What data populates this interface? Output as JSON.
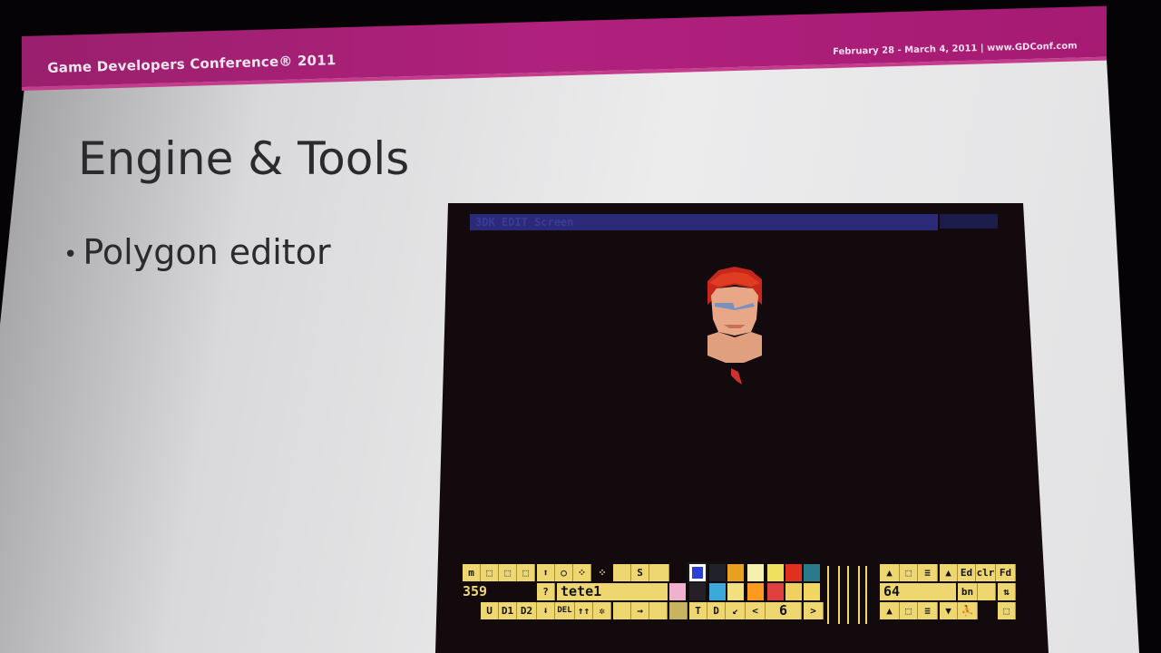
{
  "slide": {
    "conference": "Game Developers Conference® 2011",
    "dates_url": "February 28 - March 4, 2011 | www.GDConf.com",
    "title": "Engine & Tools",
    "bullets": [
      "Polygon editor"
    ]
  },
  "editor": {
    "titlebar": "3DK  EDIT  Screen",
    "titlebar_right": "",
    "toolbar": {
      "row1_left": [
        "m",
        "⬚",
        "⬚",
        "⬚",
        "⬆",
        "○",
        "⁘",
        "⁘",
        "",
        "S",
        ""
      ],
      "row1_right": [
        "▲",
        "⬚",
        "≡",
        "▲",
        "Ed",
        "clr",
        "Fd"
      ],
      "row2": {
        "count": "359",
        "help": "?",
        "object_name": "tete1",
        "value": "64",
        "right_a": "bn",
        "right_b": "⇅"
      },
      "row3_left": [
        "U",
        "D1",
        "D2",
        "⬇",
        "DEL",
        "↑↑",
        "✲",
        "",
        "→",
        "",
        ""
      ],
      "row3_mid": [
        "T",
        "D",
        "↙",
        "<",
        "6",
        ">"
      ],
      "row3_right": [
        "▲",
        "⬚",
        "≡",
        "▼",
        "⛹",
        "⬚"
      ]
    },
    "palette_row1": [
      "#2b3fd6",
      "#20222a",
      "#e8a020",
      "#f4f0b0",
      "#f0e060",
      "#e03020",
      "#2a7a8a"
    ],
    "palette_row2": [
      "#f0b0d0",
      "#252028",
      "#3aa8d8",
      "#f0e080",
      "#ff9a20",
      "#e04040",
      "#f0d060"
    ],
    "palette_row3": [
      "#f0e070",
      "#f0e8b0",
      "#f0d860"
    ]
  }
}
